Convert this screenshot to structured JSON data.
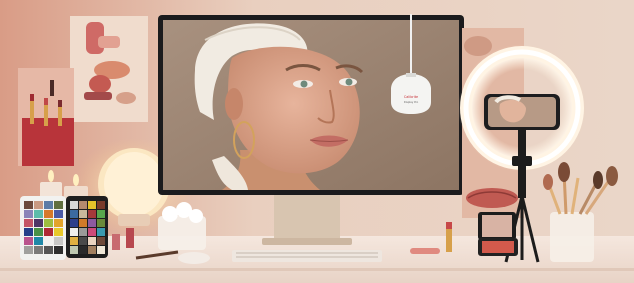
{
  "scene": {
    "subject": "Beauty desk with monitor showing a portrait, colorimeter, ring light with phone, cosmetics and color checker charts"
  },
  "monitor": {
    "calibrator_brand_text": "Calibrite",
    "calibrator_model_text": "Display Pro"
  },
  "color_checker": {
    "left_colors": [
      "#6d4a3c",
      "#c99a82",
      "#5b7ba6",
      "#5f6e3f",
      "#8a84b8",
      "#5dbcaa",
      "#d6792a",
      "#4a5aa6",
      "#c35567",
      "#4e3566",
      "#9dbd40",
      "#e3a42a",
      "#243f8a",
      "#4a9146",
      "#af2a35",
      "#e8c82a",
      "#b9548e",
      "#1f88a8",
      "#f2f2f0",
      "#c8c8c6",
      "#a0a09e",
      "#7a7a79",
      "#555555",
      "#2e2e2e"
    ],
    "right_colors": [
      "#d8d8d6",
      "#b48a6e",
      "#e6c22a",
      "#7a3b2a",
      "#3c6aa0",
      "#c9b79a",
      "#a53a3a",
      "#58a64c",
      "#2d3f8c",
      "#d17a2a",
      "#8d5aa0",
      "#6a8a3a",
      "#efefed",
      "#9a9a98",
      "#cc4a7a",
      "#3a9ab0",
      "#e0b040",
      "#4a4a4a",
      "#ead4c0",
      "#6e4a3a",
      "#bfc8b0",
      "#2a2a2a",
      "#a27f5e",
      "#f0e8d8"
    ]
  },
  "colors": {
    "wall": "#e7cdbd",
    "desk": "#f1e3da",
    "monitor_bezel": "#1b1b1d",
    "monitor_stand": "#d8c5b0",
    "ring_light": "#fff4e4",
    "frame_red": "#b8343a"
  }
}
